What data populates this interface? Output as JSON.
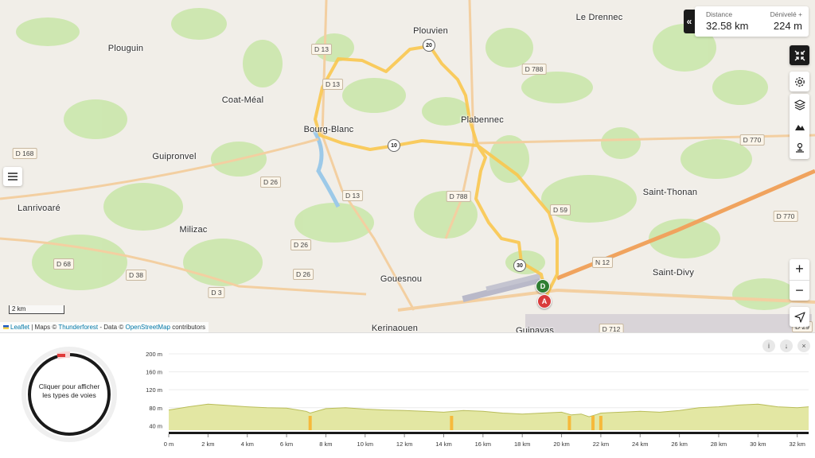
{
  "stats": {
    "distance_label": "Distance",
    "distance_value": "32.58 km",
    "elevation_label": "Dénivelé +",
    "elevation_value": "224 m"
  },
  "map": {
    "places": [
      {
        "name": "Plouvien"
      },
      {
        "name": "Le Drennec"
      },
      {
        "name": "Plouguin"
      },
      {
        "name": "Coat-Méal"
      },
      {
        "name": "Bourg-Blanc"
      },
      {
        "name": "Plabennec"
      },
      {
        "name": "Guipronvel"
      },
      {
        "name": "Saint-Thonan"
      },
      {
        "name": "Lanrivoaré"
      },
      {
        "name": "Milizac"
      },
      {
        "name": "Gouesnou"
      },
      {
        "name": "Saint-Divy"
      },
      {
        "name": "Kerinaouen"
      },
      {
        "name": "Guipavas"
      }
    ],
    "roads": [
      "D 13",
      "D 13",
      "D 788",
      "D 168",
      "D 26",
      "D 13",
      "D 788",
      "D 59",
      "D 770",
      "D 770",
      "D 26",
      "D 68",
      "D 38",
      "D 26",
      "D 3",
      "N 12",
      "D 712",
      "D 29"
    ],
    "km_markers": [
      "20",
      "10",
      "30"
    ],
    "start_label": "D",
    "end_label": "A",
    "scale_label": "2 km",
    "attribution": {
      "leaflet": "Leaflet",
      "maps": " | Maps © ",
      "thunderforest": "Thunderforest",
      "data": " - Data © ",
      "osm": "OpenStreetMap",
      "contributors": " contributors"
    },
    "route_color": "#f9c74f"
  },
  "toolbar": {
    "icons": [
      "collapse-icon",
      "fullscreen-exit-icon",
      "settings-icon",
      "layers-icon",
      "mountain-icon",
      "poi-icon",
      "zoom-in-icon",
      "zoom-out-icon",
      "locate-icon"
    ],
    "zoom_in": "+",
    "zoom_out": "−"
  },
  "panel": {
    "donut_text": "Cliquer pour afficher les types de voies",
    "buttons": [
      "info-icon",
      "download-icon",
      "close-icon"
    ],
    "info_label": "i",
    "download_label": "↓",
    "close_label": "×"
  },
  "chart_data": {
    "type": "area",
    "title": "",
    "xlabel": "",
    "ylabel": "",
    "ylim": [
      30,
      200
    ],
    "xlim": [
      0,
      32.58
    ],
    "yticks": [
      "40 m",
      "80 m",
      "120 m",
      "160 m",
      "200 m"
    ],
    "ytick_values": [
      40,
      80,
      120,
      160,
      200
    ],
    "xticks": [
      "0 m",
      "2 km",
      "4 km",
      "6 km",
      "8 km",
      "10 km",
      "12 km",
      "14 km",
      "16 km",
      "18 km",
      "20 km",
      "22 km",
      "24 km",
      "26 km",
      "28 km",
      "30 km",
      "32 km"
    ],
    "xtick_values": [
      0,
      2,
      4,
      6,
      8,
      10,
      12,
      14,
      16,
      18,
      20,
      22,
      24,
      26,
      28,
      30,
      32
    ],
    "x": [
      0,
      1,
      2,
      3,
      4,
      5,
      6,
      7,
      7.2,
      8,
      9,
      10,
      11,
      12,
      13,
      14,
      15,
      16,
      17,
      18,
      19,
      20,
      20.5,
      21,
      21.4,
      21.8,
      22,
      23,
      24,
      25,
      26,
      27,
      28,
      29,
      30,
      31,
      32,
      32.58
    ],
    "elevation": [
      75,
      82,
      88,
      85,
      82,
      80,
      79,
      72,
      68,
      78,
      80,
      77,
      75,
      74,
      72,
      70,
      74,
      72,
      68,
      66,
      68,
      70,
      64,
      66,
      60,
      65,
      68,
      70,
      72,
      70,
      74,
      80,
      82,
      86,
      88,
      82,
      80,
      82
    ],
    "highlights": [
      7.2,
      14.4,
      20.4,
      21.6,
      22.0
    ],
    "fill_color": "#e3e7a3",
    "line_color": "#b9bd5a",
    "highlight_color": "#f6b93b"
  }
}
